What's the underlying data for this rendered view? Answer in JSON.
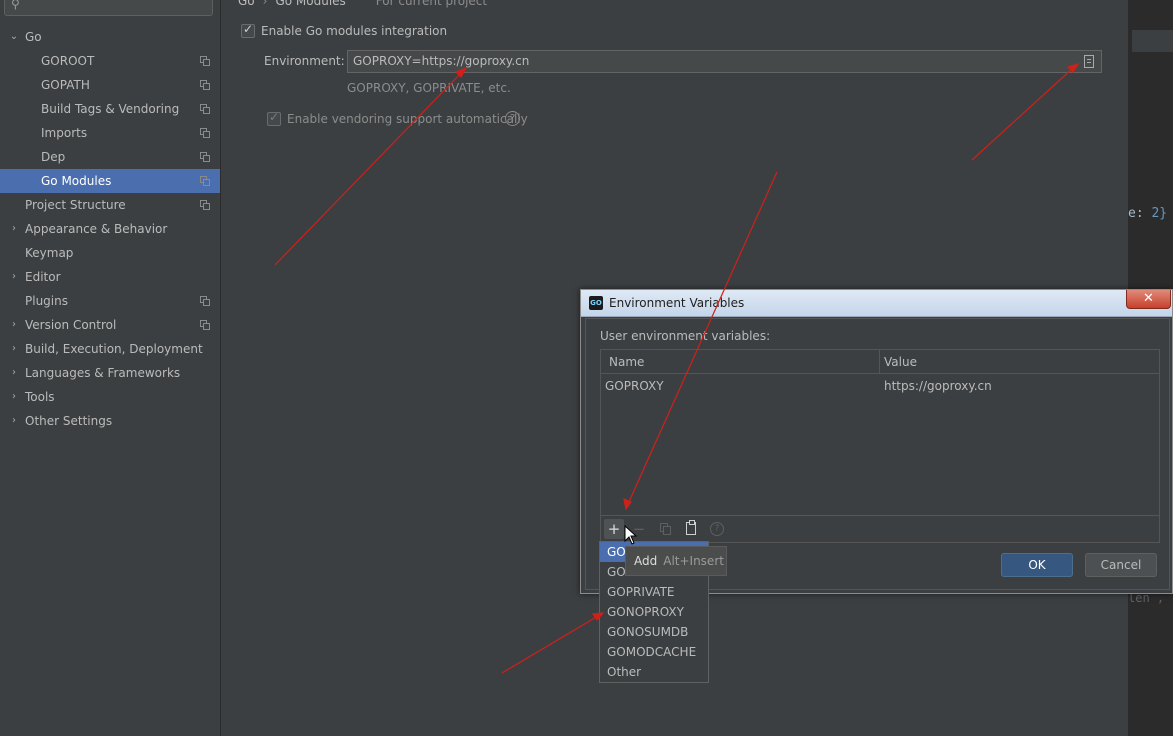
{
  "sidebar": {
    "items": [
      {
        "label": "Go",
        "arrow": "⌄"
      },
      {
        "label": "GOROOT"
      },
      {
        "label": "GOPATH"
      },
      {
        "label": "Build Tags & Vendoring"
      },
      {
        "label": "Imports"
      },
      {
        "label": "Dep"
      },
      {
        "label": "Go Modules"
      },
      {
        "label": "Project Structure"
      },
      {
        "label": "Appearance & Behavior",
        "arrow": "›"
      },
      {
        "label": "Keymap"
      },
      {
        "label": "Editor",
        "arrow": "›"
      },
      {
        "label": "Plugins"
      },
      {
        "label": "Version Control",
        "arrow": "›"
      },
      {
        "label": "Build, Execution, Deployment",
        "arrow": "›"
      },
      {
        "label": "Languages & Frameworks",
        "arrow": "›"
      },
      {
        "label": "Tools",
        "arrow": "›"
      },
      {
        "label": "Other Settings",
        "arrow": "›"
      }
    ]
  },
  "breadcrumb": {
    "part1": "Go",
    "sep": "›",
    "part2": "Go Modules",
    "note": "For current project"
  },
  "main": {
    "enable_modules_label": "Enable Go modules integration",
    "environment_label": "Environment:",
    "environment_value": "GOPROXY=https://goproxy.cn",
    "environment_hint": "GOPROXY, GOPRIVATE, etc.",
    "vendoring_label": "Enable vendoring support automatically",
    "help_glyph": "?"
  },
  "editor": {
    "code_text": "e: ",
    "code_num": "2}",
    "code_faint": "len ,"
  },
  "dialog": {
    "title": "Environment Variables",
    "app_icon_text": "GO",
    "close_glyph": "✕",
    "section_label": "User environment variables:",
    "columns": [
      "Name",
      "Value"
    ],
    "rows": [
      {
        "name": "GOPROXY",
        "value": "https://goproxy.cn"
      }
    ],
    "toolbar": {
      "add": "+",
      "remove": "−",
      "help": "?"
    },
    "ok_label": "OK",
    "cancel_label": "Cancel"
  },
  "popup": {
    "items": [
      "GO",
      "GO",
      "GOPRIVATE",
      "GONOPROXY",
      "GONOSUMDB",
      "GOMODCACHE",
      "Other"
    ]
  },
  "tooltip": {
    "text": "Add",
    "shortcut": "Alt+Insert"
  },
  "colors": {
    "selection": "#4b6eaf",
    "annotation_arrow": "#d0201a",
    "ok_button": "#365880"
  }
}
